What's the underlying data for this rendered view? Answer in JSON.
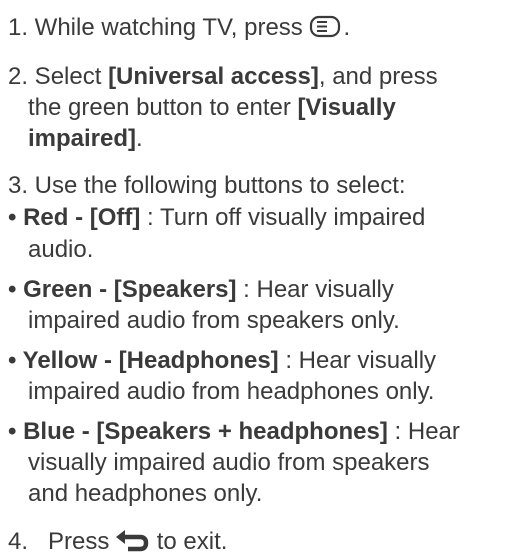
{
  "steps": {
    "s1": {
      "lead": "1. While watching TV, press",
      "tail": "."
    },
    "s2": {
      "l1a": "2. Select ",
      "l1b": "[Universal access]",
      "l1c": ", and press",
      "l2a": "the green button to enter ",
      "l2b": "[Visually",
      "l3": "impaired]",
      "l3b": "."
    },
    "s3": {
      "text": "3. Use the following buttons to select:"
    },
    "red": {
      "bullet": "• ",
      "label": "Red - [Off]",
      "d1": " : Turn off visually impaired",
      "d2": "audio."
    },
    "green": {
      "bullet": "• ",
      "label": "Green - [Speakers]",
      "d1": " : Hear visually",
      "d2": "impaired audio from speakers only."
    },
    "yellow": {
      "bullet": "• ",
      "label": "Yellow - [Headphones]",
      "d1": " : Hear visually",
      "d2": "impaired audio from headphones only."
    },
    "blue": {
      "bullet": "• ",
      "label": "Blue - [Speakers + headphones]",
      "d1": " : Hear",
      "d2": "visually impaired audio from speakers",
      "d3": "and headphones only."
    },
    "s4": {
      "a": "4.   Press ",
      "b": " to exit."
    }
  },
  "icons": {
    "options": "options-menu-icon",
    "back": "back-arrow-icon"
  },
  "colors": {
    "text": "#3a3a3a"
  }
}
